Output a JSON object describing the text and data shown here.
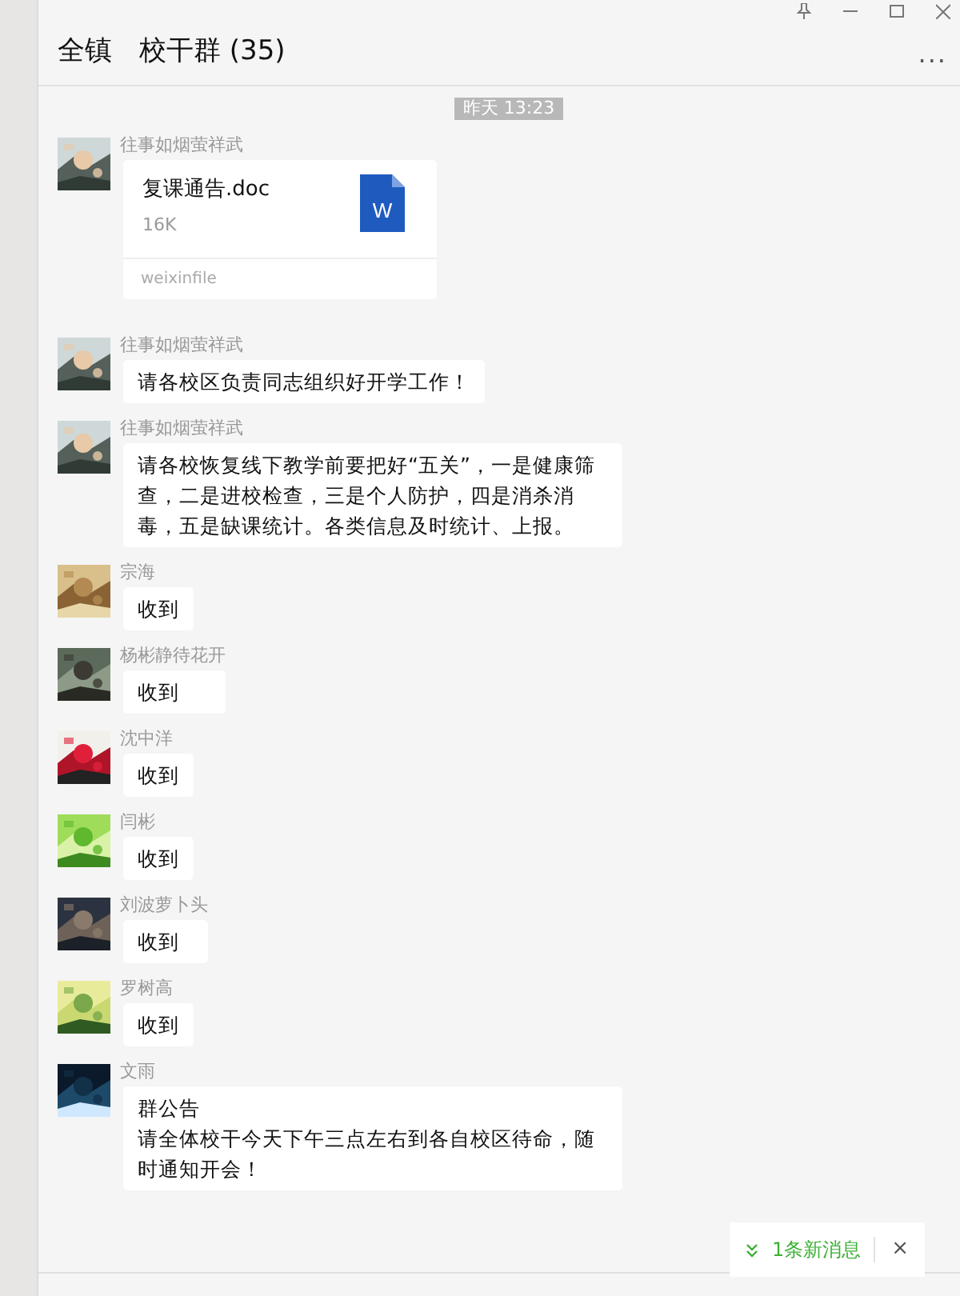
{
  "window": {
    "title": "全镇　校干群 (35)",
    "more": "..."
  },
  "timestamp": "昨天 13:23",
  "messages": [
    {
      "kind": "file",
      "sender": "往事如烟萤祥武",
      "file_name": "复课通告.doc",
      "size": "16K",
      "source": "weixinfile",
      "file_icon": "W"
    },
    {
      "kind": "text",
      "sender": "往事如烟萤祥武",
      "text": "请各校区负责同志组织好开学工作！"
    },
    {
      "kind": "text",
      "sender": "往事如烟萤祥武",
      "text": "请各校恢复线下教学前要把好“五关”，一是健康筛查，二是进校检查，三是个人防护，四是消杀消毒，五是缺课统计。各类信息及时统计、上报。"
    },
    {
      "kind": "text",
      "sender": "宗海",
      "text": "收到"
    },
    {
      "kind": "text",
      "sender": "杨彬静待花开",
      "text": "收到"
    },
    {
      "kind": "text",
      "sender": "沈中洋",
      "text": "收到"
    },
    {
      "kind": "text",
      "sender": "闫彬",
      "text": "收到"
    },
    {
      "kind": "text",
      "sender": "刘波萝卜头",
      "text": "收到"
    },
    {
      "kind": "text",
      "sender": "罗树高",
      "text": "收到"
    },
    {
      "kind": "notice",
      "sender": "文雨",
      "title": "群公告",
      "text": "请全体校干今天下午三点左右到各自校区待命，随时通知开会！"
    }
  ],
  "new_message_toast": {
    "label": "1条新消息",
    "close": "×"
  }
}
